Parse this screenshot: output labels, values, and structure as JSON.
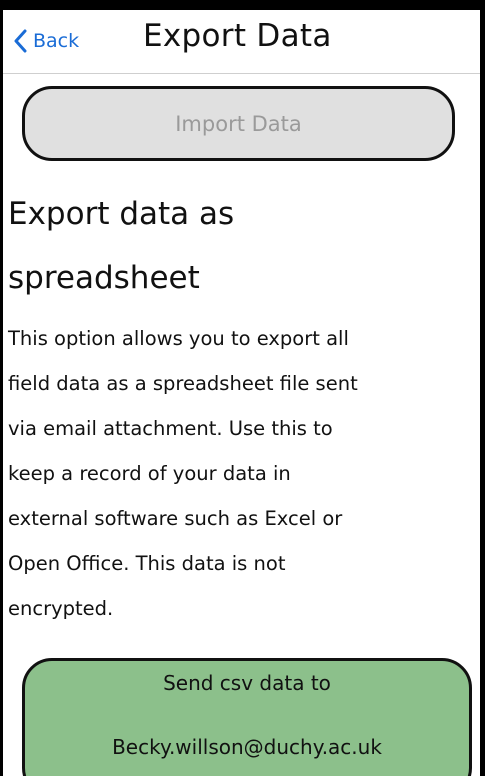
{
  "navbar": {
    "back_label": "Back",
    "title": "Export Data",
    "back_icon": "chevron-left-icon"
  },
  "import_button": {
    "label": "Import Data"
  },
  "export_section": {
    "heading_line1": "Export data as",
    "heading_line2": "spreadsheet",
    "description_lines": [
      "This option allows you to export all",
      "field data as a spreadsheet file sent",
      "via email attachment. Use this to",
      "keep a record of your data in",
      "external software such as Excel or",
      "Open Office. This data is not",
      "encrypted."
    ]
  },
  "send_button": {
    "line1": "Send csv data to",
    "line2": "Becky.willson@duchy.ac.uk"
  },
  "colors": {
    "accent": "#1a6cd6",
    "send_button_bg": "#8cc08b",
    "import_button_bg": "#e0e0e0",
    "import_button_text": "#9a9a9a"
  }
}
